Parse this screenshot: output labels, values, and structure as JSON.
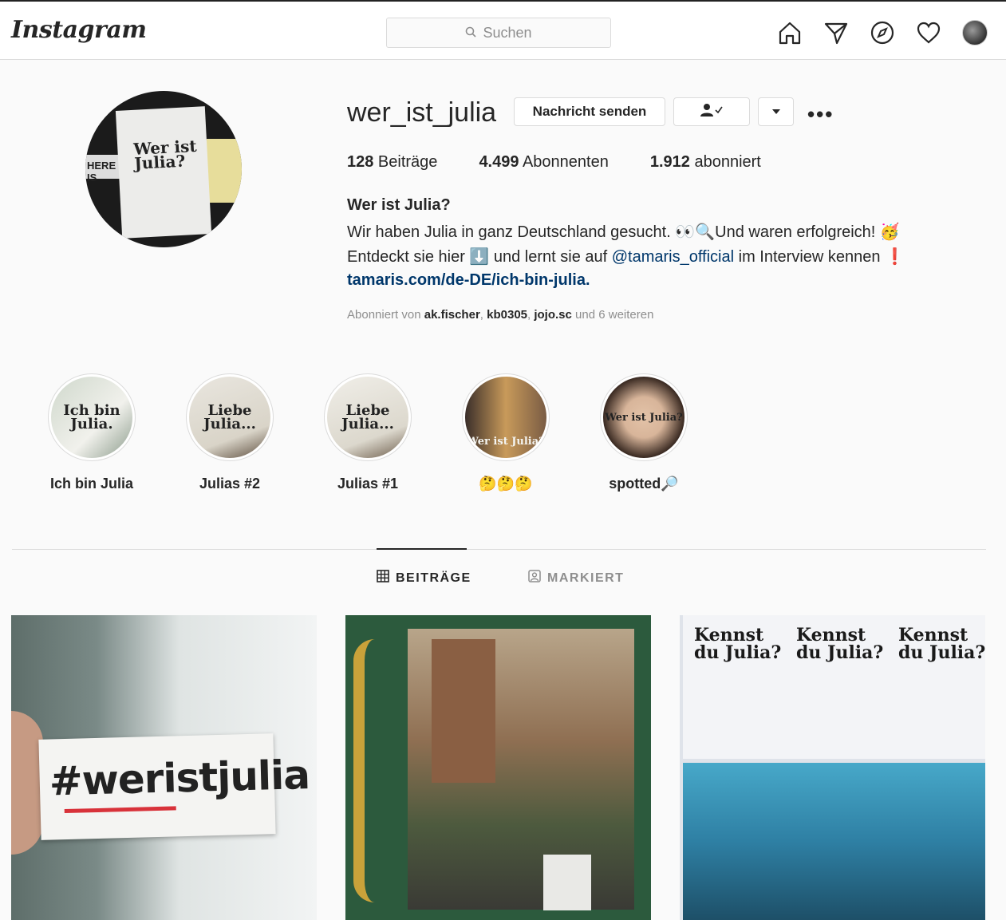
{
  "header": {
    "logo": "Instagram",
    "search_placeholder": "Suchen"
  },
  "profile": {
    "username": "wer_ist_julia",
    "message_button": "Nachricht senden",
    "follow_icon": "person-check-icon",
    "dropdown_icon": "caret-down-icon",
    "more": "•••",
    "pic_text": "Wer ist Julia?",
    "pic_strip": "HERE IS"
  },
  "stats": {
    "posts_count": "128",
    "posts_label": " Beiträge",
    "followers_count": "4.499",
    "followers_label": " Abonnenten",
    "following_count": "1.912",
    "following_label": " abonniert"
  },
  "bio": {
    "name": "Wer ist Julia?",
    "line1": "Wir haben Julia in ganz Deutschland gesucht. 👀🔍Und waren erfolgreich! 🥳",
    "line2_pre": "Entdeckt sie hier ⬇️ und lernt sie auf ",
    "line2_mention": "@tamaris_official",
    "line2_post": " im Interview kennen ❗",
    "link": "tamaris.com/de-DE/ich-bin-julia."
  },
  "followed_by": {
    "prefix": "Abonniert von ",
    "user1": "ak.fischer",
    "sep1": ", ",
    "user2": "kb0305",
    "sep2": ", ",
    "user3": "jojo.sc",
    "suffix": " und 6 weiteren"
  },
  "highlights": [
    {
      "label": "Ich bin Julia",
      "text": "Ich bin Julia."
    },
    {
      "label": "Julias #2",
      "text": "Liebe Julia..."
    },
    {
      "label": "Julias #1",
      "text": "Liebe Julia..."
    },
    {
      "label": "🤔🤔🤔",
      "text": "Wer ist Julia?"
    },
    {
      "label": "spotted🔎",
      "text": "Wer ist Julia?"
    }
  ],
  "tabs": {
    "posts": "BEITRÄGE",
    "tagged": "MARKIERT"
  },
  "posts": {
    "p1_text": "#weristjulia",
    "p3_poster": "Kennst du Julia?"
  },
  "colors": {
    "link": "#00376b",
    "border": "#dbdbdb",
    "text": "#262626",
    "muted": "#8e8e8e"
  }
}
